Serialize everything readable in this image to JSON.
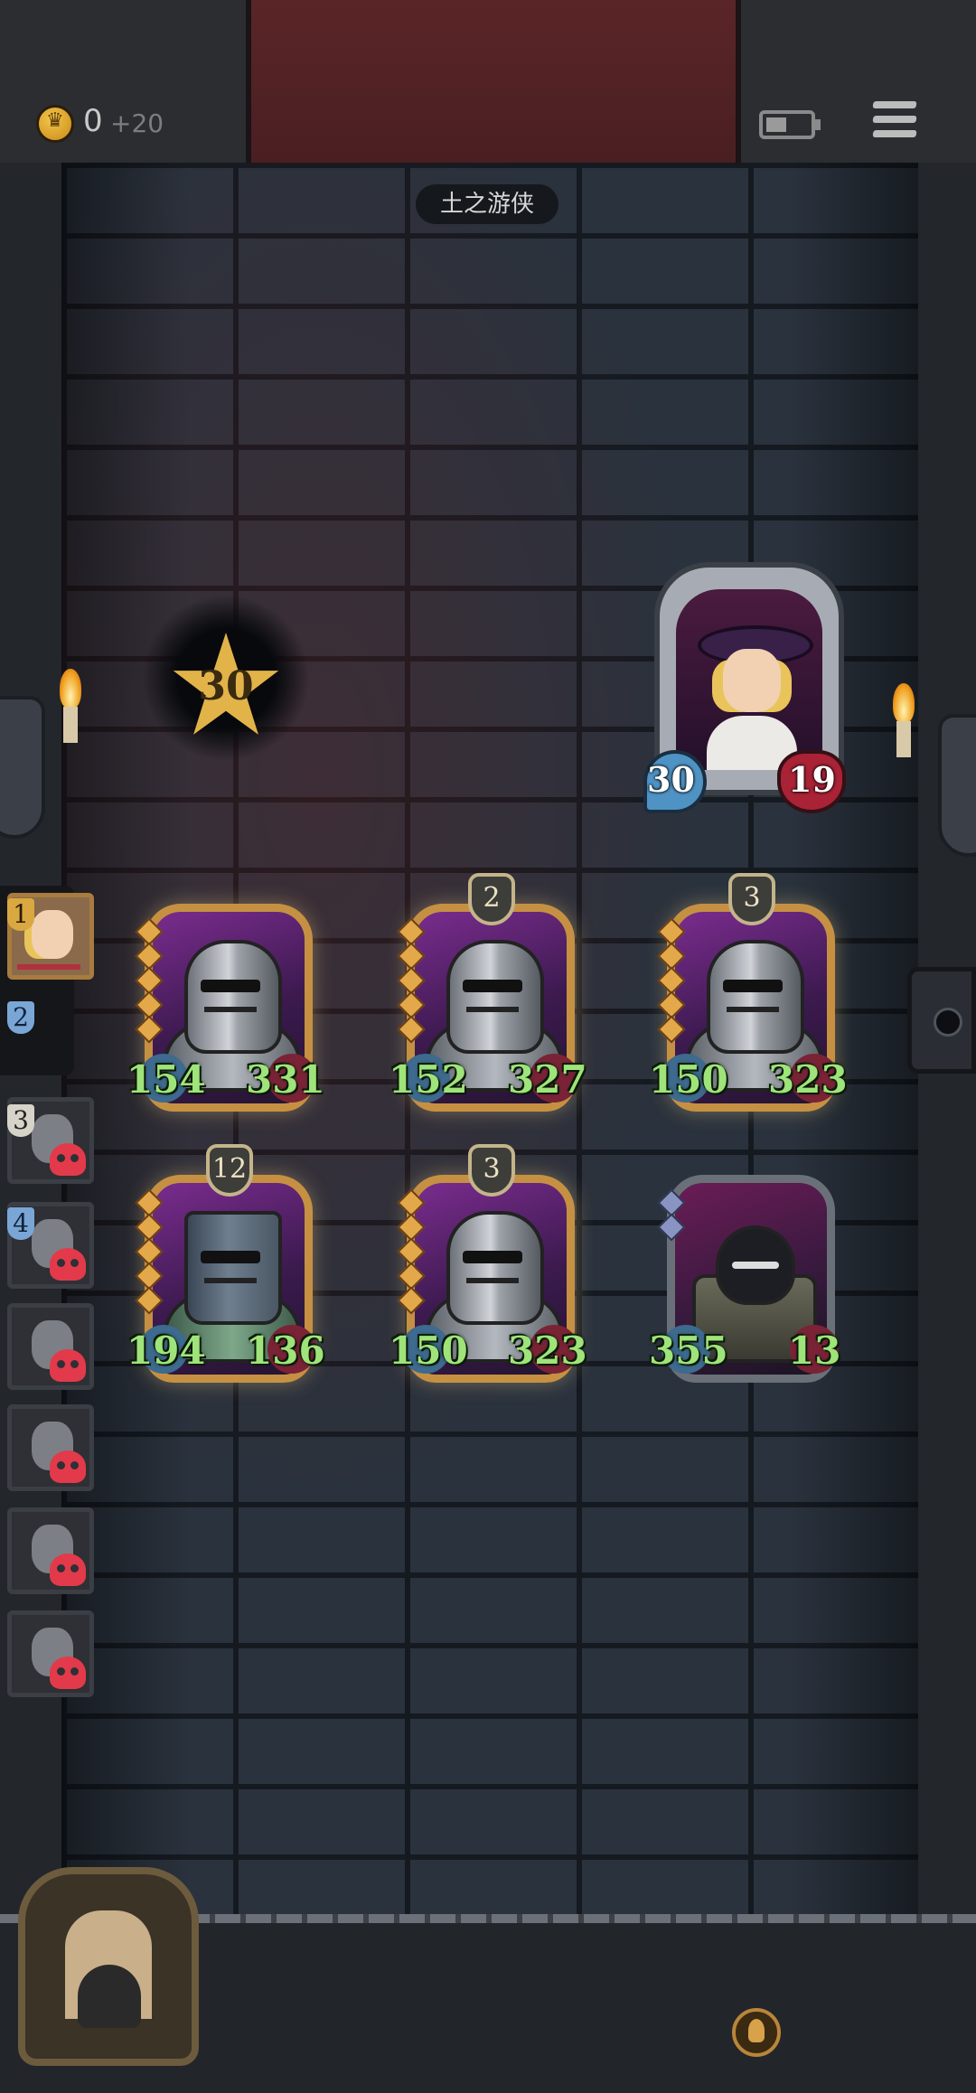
{
  "hud": {
    "gold": "0",
    "gold_gain": "+20",
    "location": "土之游侠"
  },
  "wall_star": {
    "value": "30"
  },
  "boss": {
    "attack": "30",
    "health": "19"
  },
  "units": [
    {
      "level": "",
      "attack": "154",
      "health": "331",
      "type": "knight"
    },
    {
      "level": "2",
      "attack": "152",
      "health": "327",
      "type": "knight"
    },
    {
      "level": "3",
      "attack": "150",
      "health": "323",
      "type": "knight"
    },
    {
      "level": "12",
      "attack": "194",
      "health": "136",
      "type": "frank"
    },
    {
      "level": "3",
      "attack": "150",
      "health": "323",
      "type": "knight"
    },
    {
      "level": "",
      "attack": "355",
      "health": "13",
      "type": "dark-shield"
    }
  ],
  "turn_order": {
    "current_label": "1",
    "next_label": "2",
    "defeated": [
      {
        "label": "3"
      },
      {
        "label": "4"
      },
      {
        "label": ""
      },
      {
        "label": ""
      },
      {
        "label": ""
      },
      {
        "label": ""
      }
    ]
  },
  "colors": {
    "stat_green": "#9ee47a",
    "card_gold": "#c69043",
    "skull_red": "#e23a4a"
  }
}
